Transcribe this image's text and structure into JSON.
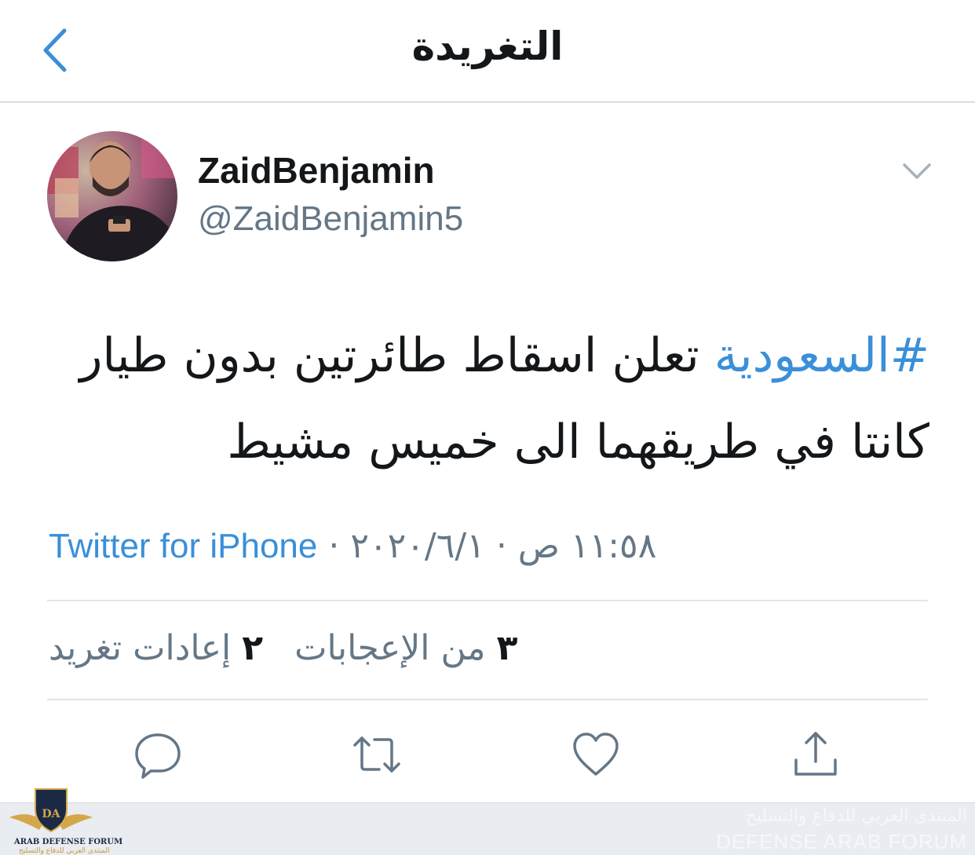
{
  "header": {
    "title": "التغريدة",
    "back_icon": "chevron-left-icon"
  },
  "author": {
    "display_name": "ZaidBenjamin",
    "handle": "@ZaidBenjamin5",
    "menu_icon": "chevron-down-icon"
  },
  "tweet": {
    "hashtag": "#السعودية",
    "text": " تعلن اسقاط طائرتين بدون طيار كانتا في طريقهما الى خميس مشيط",
    "timestamp": "١١:٥٨ ص · ٢٠٢٠/٦/١",
    "separator": "·",
    "source": "Twitter for iPhone"
  },
  "stats": {
    "retweets_count": "٢",
    "retweets_label": "إعادات تغريد",
    "likes_count": "٣",
    "likes_label": "من الإعجابات"
  },
  "actions": [
    {
      "name": "reply",
      "icon": "reply-icon"
    },
    {
      "name": "retweet",
      "icon": "retweet-icon"
    },
    {
      "name": "like",
      "icon": "heart-icon"
    },
    {
      "name": "share",
      "icon": "share-icon"
    }
  ],
  "watermark": {
    "logo_text": "DA",
    "name_en": "ARAB DEFENSE FORUM",
    "name_ar": "المنتدى العربي للدفاع والتسليح",
    "right_ar": "المنتدى العربي للدفاع والتسليح",
    "right_en": "DEFENSE ARAB FORUM"
  },
  "colors": {
    "accent": "#3a8fd9",
    "secondary_text": "#657786",
    "primary_text": "#14171a",
    "divider": "#e1e6ea"
  }
}
